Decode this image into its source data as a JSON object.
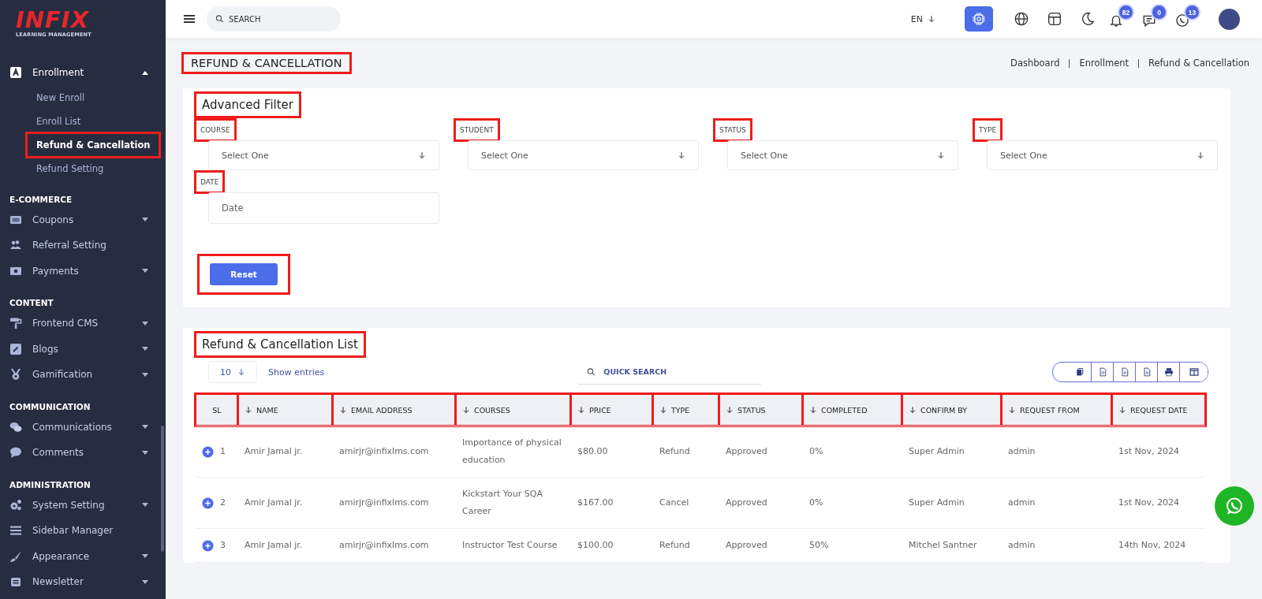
{
  "sidebar": {
    "logo": {
      "name": "INFIX",
      "tagline": "LEARNING MANAGEMENT"
    },
    "groups": [
      {
        "items": [
          {
            "label": "Enrollment",
            "expanded": true,
            "children": [
              {
                "label": "New Enroll",
                "selected": false,
                "highlighted": false
              },
              {
                "label": "Enroll List",
                "selected": false,
                "highlighted": false
              },
              {
                "label": "Refund & Cancellation",
                "selected": true,
                "highlighted": true
              },
              {
                "label": "Refund Setting",
                "selected": false,
                "highlighted": false
              }
            ]
          }
        ]
      },
      {
        "heading": "E-COMMERCE",
        "items": [
          {
            "label": "Coupons",
            "expanded": false
          },
          {
            "label": "Referral Setting"
          },
          {
            "label": "Payments",
            "expanded": false
          }
        ]
      },
      {
        "heading": "CONTENT",
        "items": [
          {
            "label": "Frontend CMS",
            "expanded": false
          },
          {
            "label": "Blogs",
            "expanded": false
          },
          {
            "label": "Gamification",
            "expanded": false
          }
        ]
      },
      {
        "heading": "COMMUNICATION",
        "items": [
          {
            "label": "Communications",
            "expanded": false
          },
          {
            "label": "Comments",
            "expanded": false
          }
        ]
      },
      {
        "heading": "ADMINISTRATION",
        "items": [
          {
            "label": "System Setting",
            "expanded": false
          },
          {
            "label": "Sidebar Manager"
          },
          {
            "label": "Appearance",
            "expanded": false
          },
          {
            "label": "Newsletter",
            "expanded": false
          }
        ]
      }
    ]
  },
  "topbar": {
    "search": {
      "placeholder": "SEARCH"
    },
    "language": "EN",
    "badges": [
      "82",
      "0",
      "13"
    ]
  },
  "page": {
    "title": "REFUND & CANCELLATION",
    "title_highlighted": true,
    "breadcrumb": [
      "Dashboard",
      "Enrollment",
      "Refund & Cancellation"
    ]
  },
  "filter": {
    "title": "Advanced Filter",
    "title_highlighted": true,
    "fields": [
      {
        "label": "COURSE",
        "value": "Select One",
        "highlighted": true
      },
      {
        "label": "STUDENT",
        "value": "Select One",
        "highlighted": true
      },
      {
        "label": "STATUS",
        "value": "Select One",
        "highlighted": true
      },
      {
        "label": "TYPE",
        "value": "Select One",
        "highlighted": true
      }
    ],
    "date": {
      "label": "DATE",
      "placeholder": "Date",
      "highlighted": true
    },
    "reset": {
      "label": "Reset",
      "highlighted": true
    }
  },
  "list": {
    "title": "Refund & Cancellation List",
    "title_highlighted": true,
    "page_size": "10",
    "show_entries": "Show entries",
    "search": {
      "placeholder": "QUICK SEARCH"
    },
    "columns": [
      {
        "label": "SL",
        "highlighted": true
      },
      {
        "label": "NAME",
        "highlighted": true
      },
      {
        "label": "EMAIL ADDRESS",
        "highlighted": true
      },
      {
        "label": "COURSES",
        "highlighted": true
      },
      {
        "label": "PRICE",
        "highlighted": true
      },
      {
        "label": "TYPE",
        "highlighted": true
      },
      {
        "label": "STATUS",
        "highlighted": true
      },
      {
        "label": "COMPLETED",
        "highlighted": true
      },
      {
        "label": "CONFIRM BY",
        "highlighted": true
      },
      {
        "label": "REQUEST FROM",
        "highlighted": true
      },
      {
        "label": "REQUEST DATE",
        "highlighted": true
      }
    ],
    "rows": [
      [
        "1",
        "Amir Jamal jr.",
        "amirjr@infixlms.com",
        "Importance of physical education",
        "$80.00",
        "Refund",
        "Approved",
        "0%",
        "Super Admin",
        "admin",
        "1st Nov, 2024"
      ],
      [
        "2",
        "Amir Jamal jr.",
        "amirjr@infixlms.com",
        "Kickstart Your SQA Career",
        "$167.00",
        "Cancel",
        "Approved",
        "0%",
        "Super Admin",
        "admin",
        "1st Nov, 2024"
      ],
      [
        "3",
        "Amir Jamal jr.",
        "amirjr@infixlms.com",
        "Instructor Test Course",
        "$100.00",
        "Refund",
        "Approved",
        "50%",
        "Mitchel Santner",
        "admin",
        "14th Nov, 2024"
      ]
    ]
  }
}
